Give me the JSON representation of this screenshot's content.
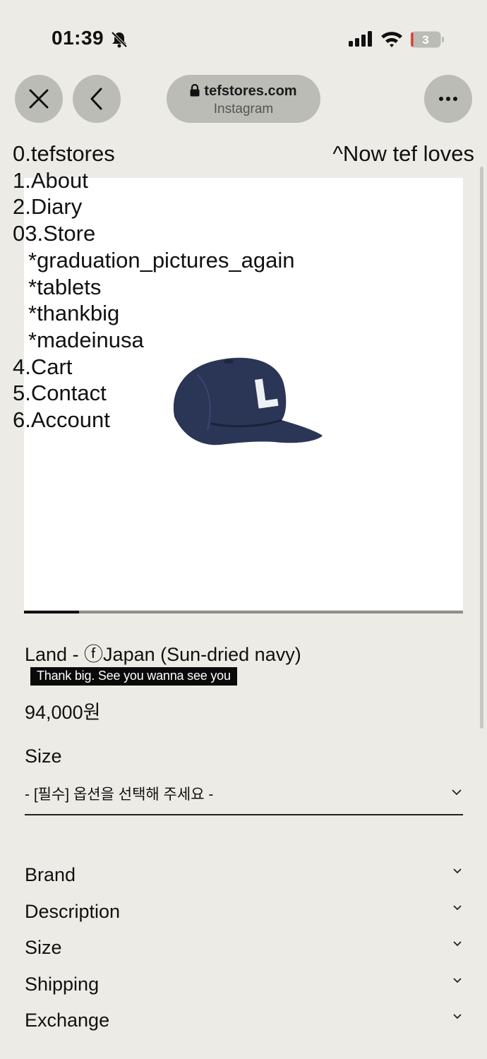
{
  "status_bar": {
    "time": "01:39",
    "battery_level": "3"
  },
  "browser": {
    "domain": "tefstores.com",
    "source": "Instagram"
  },
  "menu": {
    "items": [
      {
        "label": "0.tefstores"
      },
      {
        "label": "1.About"
      },
      {
        "label": "2.Diary"
      },
      {
        "label": "03.Store"
      },
      {
        "label": "*graduation_pictures_again",
        "sub": true
      },
      {
        "label": "*tablets",
        "sub": true
      },
      {
        "label": "*thankbig",
        "sub": true
      },
      {
        "label": "*madeinusa",
        "sub": true
      },
      {
        "label": "4.Cart"
      },
      {
        "label": "5.Contact"
      },
      {
        "label": "6.Account"
      }
    ],
    "now_link": "^Now tef loves"
  },
  "gallery": {
    "progress_fraction": 0.125,
    "hat_color": "#2b3556",
    "letter": "L"
  },
  "product": {
    "title": "Land - ⓕJapan (Sun-dried navy)",
    "tagline": "Thank big. See you wanna see you",
    "price": "94,000원",
    "size_label": "Size",
    "size_placeholder": "- [필수] 옵션을 선택해 주세요 -"
  },
  "accordion": [
    "Brand",
    "Description",
    "Size",
    "Shipping",
    "Exchange"
  ]
}
